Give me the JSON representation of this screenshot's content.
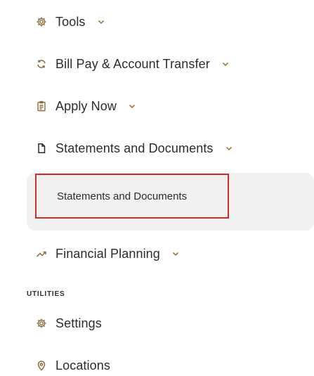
{
  "nav": {
    "tools": {
      "label": "Tools",
      "icon": "gear-icon"
    },
    "bill_pay": {
      "label": "Bill Pay & Account Transfer",
      "icon": "refresh-arrows-icon"
    },
    "apply_now": {
      "label": "Apply Now",
      "icon": "clipboard-icon"
    },
    "statements": {
      "label": "Statements and Documents",
      "icon": "document-icon"
    },
    "financial_planning": {
      "label": "Financial Planning",
      "icon": "trend-line-icon"
    }
  },
  "submenu": {
    "statements_item": {
      "label": "Statements and Documents"
    }
  },
  "utilities": {
    "header": "UTILITIES",
    "settings": {
      "label": "Settings",
      "icon": "gear-icon"
    },
    "locations": {
      "label": "Locations",
      "icon": "location-pin-icon"
    }
  },
  "colors": {
    "icon": "#8a6d3b",
    "chevron": "#a07a3a",
    "submenu_bg": "#f1f1f0",
    "highlight_border": "#d12b2b"
  }
}
